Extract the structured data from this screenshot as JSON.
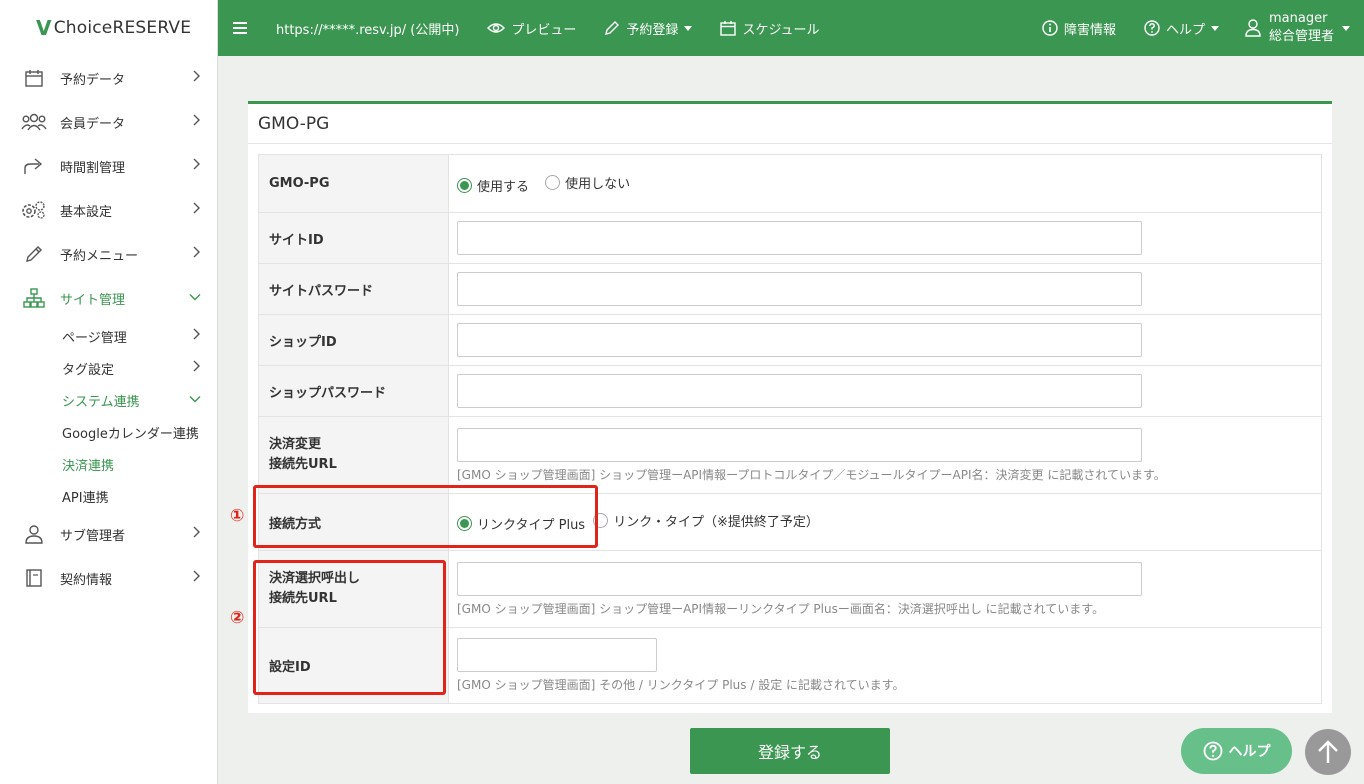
{
  "logo": {
    "check": "V",
    "text": "ChoiceRESERVE"
  },
  "sidebar": {
    "items": [
      {
        "label": "予約データ"
      },
      {
        "label": "会員データ"
      },
      {
        "label": "時間割管理"
      },
      {
        "label": "基本設定"
      },
      {
        "label": "予約メニュー"
      },
      {
        "label": "サイト管理"
      }
    ],
    "sub_items": [
      {
        "label": "ページ管理"
      },
      {
        "label": "タグ設定"
      },
      {
        "label": "システム連携"
      }
    ],
    "subsub_items": [
      {
        "label": "Googleカレンダー連携"
      },
      {
        "label": "決済連携"
      },
      {
        "label": "API連携"
      }
    ],
    "bottom_items": [
      {
        "label": "サブ管理者"
      },
      {
        "label": "契約情報"
      }
    ]
  },
  "topbar": {
    "url": "https://*****.resv.jp/ (公開中)",
    "preview": "プレビュー",
    "reserve": "予約登録",
    "schedule": "スケジュール",
    "incident": "障害情報",
    "help": "ヘルプ",
    "user_name": "manager",
    "user_role": "総合管理者"
  },
  "card": {
    "title": "GMO-PG",
    "rows": {
      "gmo": {
        "label": "GMO-PG",
        "opt_use": "使用する",
        "opt_nouse": "使用しない"
      },
      "site_id": {
        "label": "サイトID"
      },
      "site_pw": {
        "label": "サイトパスワード"
      },
      "shop_id": {
        "label": "ショップID"
      },
      "shop_pw": {
        "label": "ショップパスワード"
      },
      "change_url": {
        "label1": "決済変更",
        "label2": "接続先URL",
        "note": "[GMO ショップ管理画面] ショップ管理ーAPI情報ープロトコルタイプ／モジュールタイプーAPI名：決済変更 に記載されています。"
      },
      "method": {
        "label": "接続方式",
        "opt_plus": "リンクタイプ Plus",
        "opt_link": "リンク・タイプ（※提供終了予定）"
      },
      "select_url": {
        "label1": "決済選択呼出し",
        "label2": "接続先URL",
        "note": "[GMO ショップ管理画面] ショップ管理ーAPI情報ーリンクタイプ Plusー画面名：決済選択呼出し に記載されています。"
      },
      "config_id": {
        "label": "設定ID",
        "note": "[GMO ショップ管理画面] その他 / リンクタイプ Plus / 設定 に記載されています。"
      }
    }
  },
  "markers": {
    "one": "①",
    "two": "②"
  },
  "buttons": {
    "submit": "登録する",
    "help": "ヘルプ"
  },
  "colors": {
    "brand": "#3a9651",
    "highlight": "#e2231a"
  }
}
